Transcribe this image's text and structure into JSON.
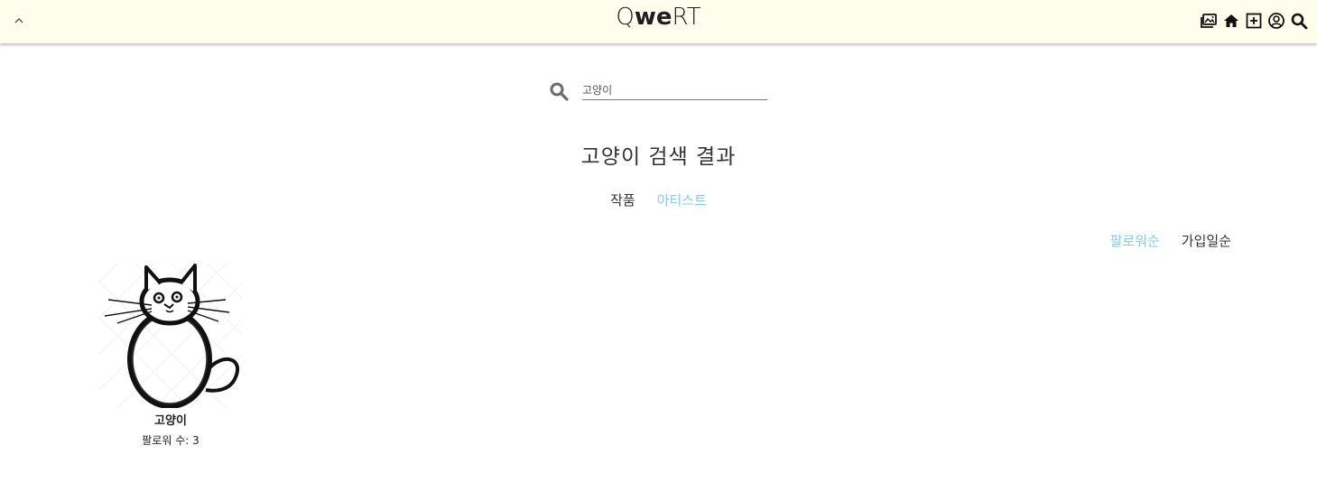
{
  "header": {
    "logo": {
      "part1": "Q",
      "part2": "we",
      "part3": "RT"
    },
    "collapse_icon": "chevron-up-icon",
    "icons": [
      "gallery-icon",
      "home-icon",
      "add-square-icon",
      "user-circle-icon",
      "search-icon"
    ],
    "background": "#fffdeb"
  },
  "search": {
    "value": "고양이",
    "icon": "search-icon"
  },
  "results": {
    "title": "고양이 검색 결과"
  },
  "tabs": [
    {
      "label": "작품",
      "active": false
    },
    {
      "label": "아티스트",
      "active": true
    }
  ],
  "sort": [
    {
      "label": "팔로워순",
      "active": true
    },
    {
      "label": "가입일순",
      "active": false
    }
  ],
  "artists": [
    {
      "name": "고양이",
      "followers": "팔로워 수: 3"
    }
  ],
  "colors": {
    "accent": "#85cbe4",
    "text": "#333333"
  }
}
